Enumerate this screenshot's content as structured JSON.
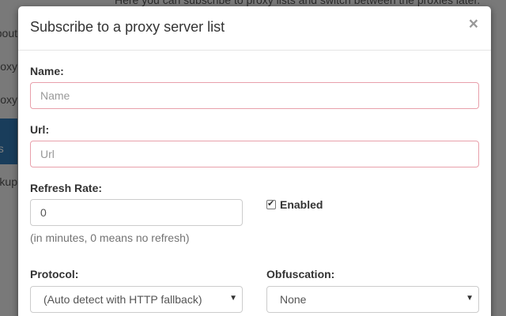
{
  "background": {
    "top_text": "Here you can subscribe to proxy lists and switch between the proxies later.",
    "nav_items": [
      "About",
      "Proxy",
      "Proxy",
      "Proxy Scripts",
      "Backup"
    ]
  },
  "modal": {
    "title": "Subscribe to a proxy server list",
    "close_label": "×",
    "name": {
      "label": "Name:",
      "placeholder": "Name",
      "value": ""
    },
    "url": {
      "label": "Url:",
      "placeholder": "Url",
      "value": ""
    },
    "refresh_rate": {
      "label": "Refresh Rate:",
      "value": "0",
      "help": "(in minutes, 0 means no refresh)"
    },
    "enabled": {
      "label": "Enabled",
      "checked": true
    },
    "protocol": {
      "label": "Protocol:",
      "selected": "(Auto detect with HTTP fallback)"
    },
    "obfuscation": {
      "label": "Obfuscation:",
      "selected": "None"
    }
  },
  "icons": {
    "dropdown_caret": "▼",
    "check": "checkmark"
  },
  "colors": {
    "error_border": "#e8a0ab",
    "nav_active": "#337ab7"
  }
}
